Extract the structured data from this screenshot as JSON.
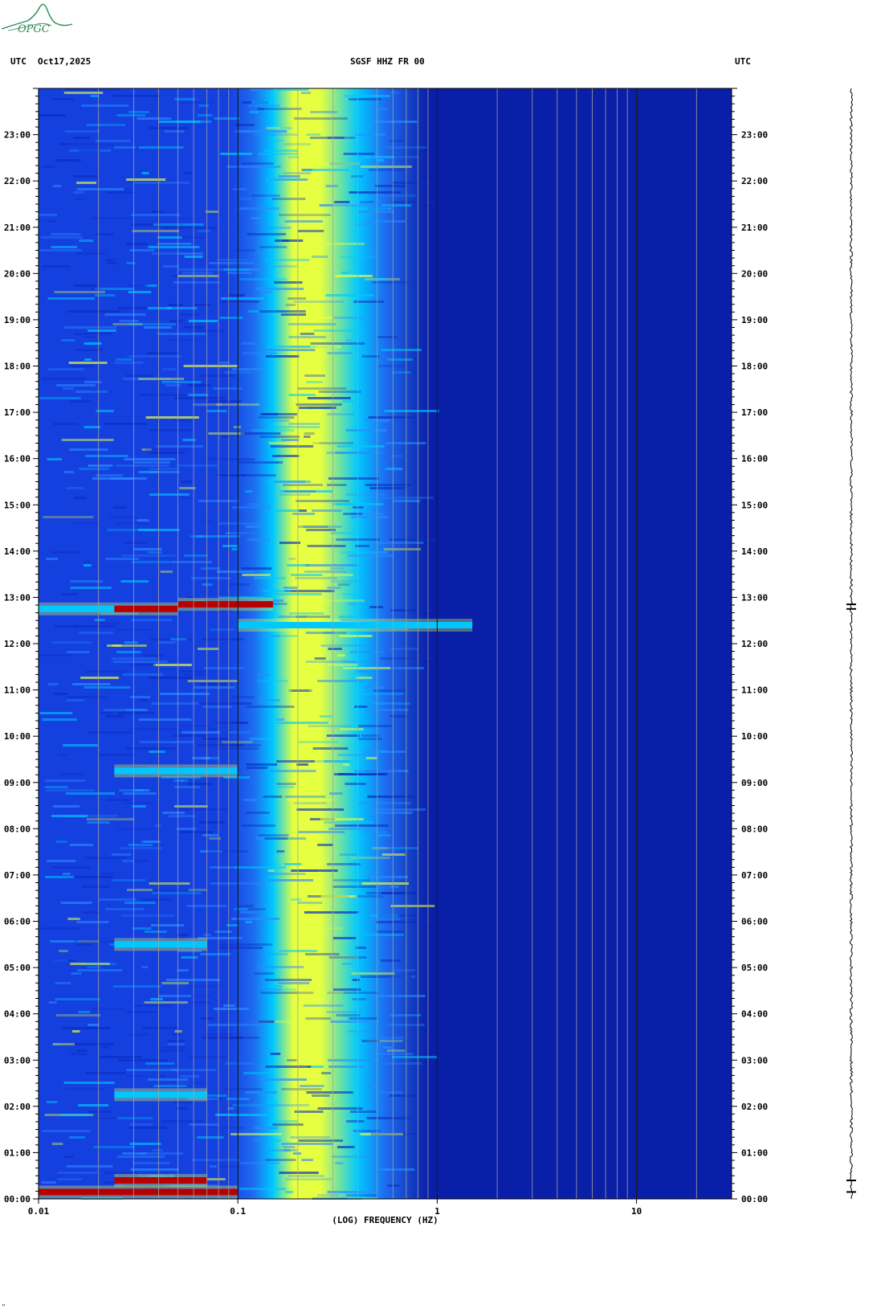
{
  "header": {
    "left_zone": "UTC",
    "date": "Oct17,2025",
    "station": "SGSF HHZ FR 00",
    "right_zone": "UTC"
  },
  "logo": {
    "text": "OPGC",
    "color": "#2e8b57"
  },
  "footer_mark": "\"",
  "colors": {
    "background_blue": "#0a1fa8",
    "low": "#1540e0",
    "mid": "#00c8ff",
    "high": "#e6ff40",
    "peak": "#b80000",
    "grid_light": "#a0a0a0",
    "grid_dark": "#1a1a1a"
  },
  "chart_data": {
    "type": "heatmap",
    "title": "SGSF HHZ FR 00",
    "xlabel": "(LOG) FREQUENCY (HZ)",
    "x_scale": "log",
    "xlim": [
      0.01,
      30
    ],
    "x_ticks": [
      {
        "value": 0.01,
        "label": "0.01"
      },
      {
        "value": 0.1,
        "label": "0.1"
      },
      {
        "value": 1,
        "label": "1"
      },
      {
        "value": 10,
        "label": "10"
      }
    ],
    "ylabel_left": "UTC",
    "ylabel_right": "UTC",
    "ylim_hours": [
      0,
      24
    ],
    "y_ticks": [
      "00:00",
      "01:00",
      "02:00",
      "03:00",
      "04:00",
      "05:00",
      "06:00",
      "07:00",
      "08:00",
      "09:00",
      "10:00",
      "11:00",
      "12:00",
      "13:00",
      "14:00",
      "15:00",
      "16:00",
      "17:00",
      "18:00",
      "19:00",
      "20:00",
      "21:00",
      "22:00",
      "23:00"
    ],
    "microseism_band_hz": [
      0.15,
      0.4
    ],
    "events": [
      {
        "time_hours": 0.15,
        "freq_hz": [
          0.01,
          0.1
        ],
        "level": "peak"
      },
      {
        "time_hours": 0.4,
        "freq_hz": [
          0.024,
          0.07
        ],
        "level": "peak"
      },
      {
        "time_hours": 2.25,
        "freq_hz": [
          0.024,
          0.07
        ],
        "level": "mid"
      },
      {
        "time_hours": 5.5,
        "freq_hz": [
          0.024,
          0.07
        ],
        "level": "mid"
      },
      {
        "time_hours": 9.25,
        "freq_hz": [
          0.024,
          0.1
        ],
        "level": "mid"
      },
      {
        "time_hours": 12.4,
        "freq_hz": [
          0.1,
          1.5
        ],
        "level": "mid"
      },
      {
        "time_hours": 12.75,
        "freq_hz": [
          0.01,
          0.024
        ],
        "level": "mid"
      },
      {
        "time_hours": 12.75,
        "freq_hz": [
          0.024,
          0.05
        ],
        "level": "peak"
      },
      {
        "time_hours": 12.85,
        "freq_hz": [
          0.05,
          0.15
        ],
        "level": "peak"
      }
    ]
  }
}
